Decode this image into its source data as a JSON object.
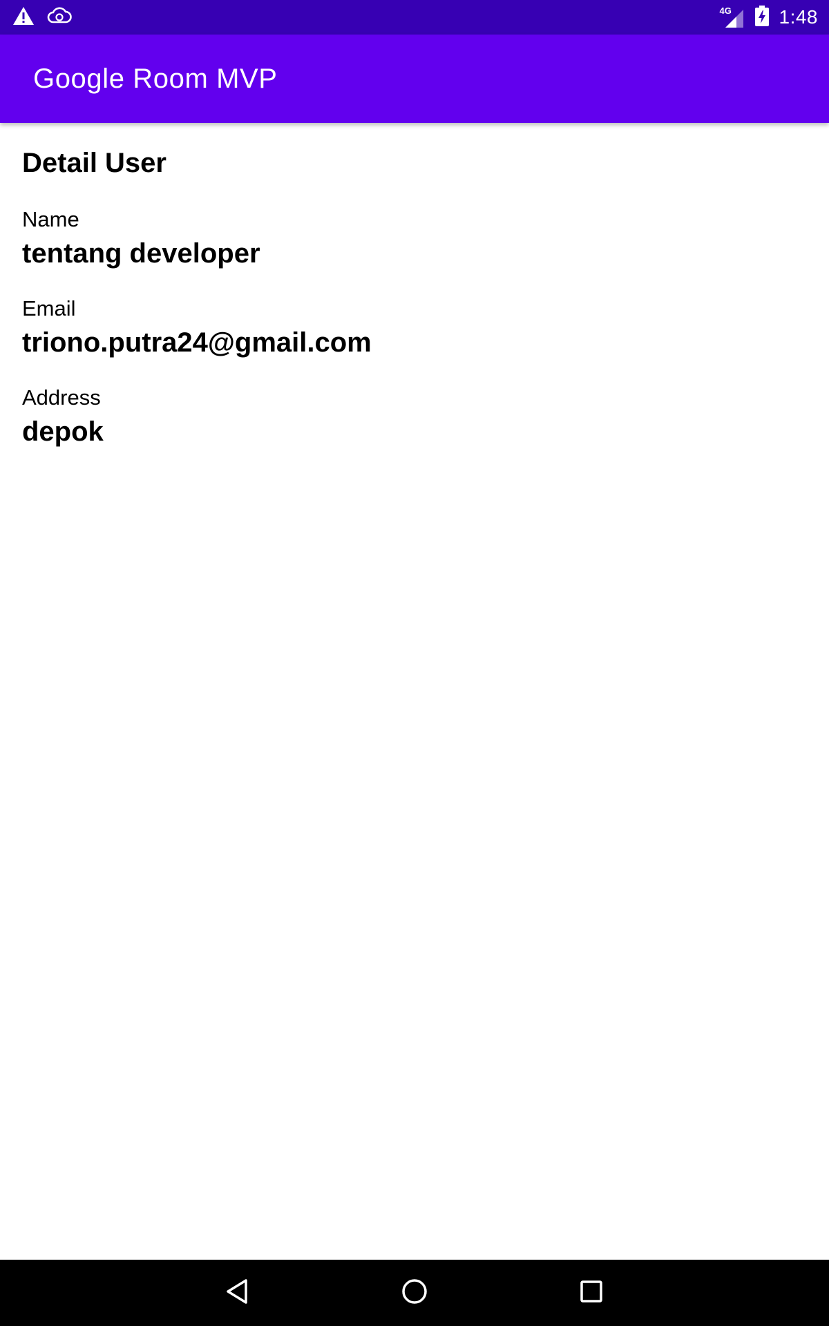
{
  "status_bar": {
    "time": "1:48",
    "network": "4G",
    "icons": [
      "warning-icon",
      "cloud-sync-icon",
      "signal-icon",
      "battery-charging-icon"
    ]
  },
  "app_bar": {
    "title": "Google Room MVP"
  },
  "detail": {
    "heading": "Detail User",
    "fields": [
      {
        "label": "Name",
        "value": "tentang developer"
      },
      {
        "label": "Email",
        "value": "triono.putra24@gmail.com"
      },
      {
        "label": "Address",
        "value": "depok"
      }
    ]
  },
  "nav_bar": {
    "icons": [
      "back-icon",
      "home-icon",
      "recents-icon"
    ]
  },
  "colors": {
    "status_bar": "#3700b3",
    "app_bar": "#6200ee",
    "nav_bar": "#000000"
  }
}
